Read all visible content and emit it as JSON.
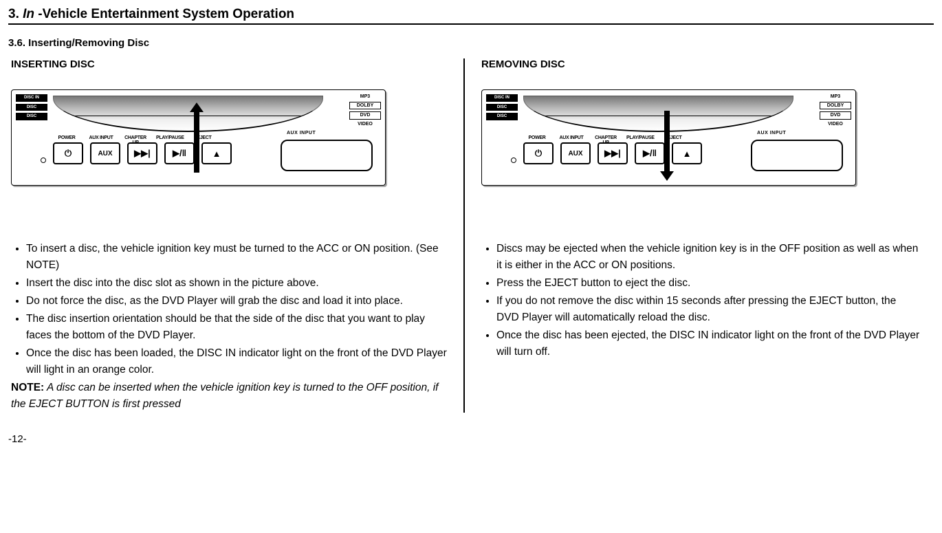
{
  "header": {
    "chapter_num": "3.",
    "chapter_italic": "In",
    "chapter_rest": " -Vehicle Entertainment System Operation"
  },
  "section": {
    "number_title": "3.6. Inserting/Removing Disc"
  },
  "panel": {
    "aux_input_label": "AUX INPUT",
    "btn_labels": {
      "power": "POWER",
      "aux": "AUX INPUT",
      "chapter": "CHAPTER UP",
      "playpause": "PLAY/PAUSE",
      "eject": "EJECT"
    },
    "btn_text": {
      "aux": "AUX"
    },
    "left_logos": [
      "DISC IN",
      "DISC",
      "DISC"
    ],
    "right_logos": [
      "MP3",
      "DOLBY",
      "DVD",
      "VIDEO"
    ]
  },
  "left": {
    "heading": "INSERTING DISC",
    "bullets": [
      "To insert a disc, the vehicle ignition key must be turned to the ACC or ON position. (See NOTE)",
      "Insert the disc into the disc slot as shown in the picture above.",
      "Do not force the disc, as the DVD Player will grab the disc and load it into place.",
      "The disc insertion orientation should be that the side of the disc that you want to play faces the bottom of the DVD Player.",
      "Once the disc has been loaded, the DISC IN indicator light on the front of the DVD Player will light in an orange color."
    ],
    "note_prefix": "NOTE:",
    "note_body": " A disc can be inserted when the vehicle ignition key is turned to the OFF position, if the EJECT BUTTON is first pressed"
  },
  "right": {
    "heading": "REMOVING DISC",
    "bullets": [
      "Discs may be ejected when the vehicle ignition key is in the OFF position as well as when it is either in the ACC or ON positions.",
      "Press the EJECT button to eject the disc.",
      "If you do not remove the disc within 15 seconds after pressing the EJECT button, the DVD Player will automatically reload the disc.",
      "Once the disc has been ejected, the DISC IN indicator light on the front of the DVD Player will turn off."
    ]
  },
  "page_number": "-12-"
}
